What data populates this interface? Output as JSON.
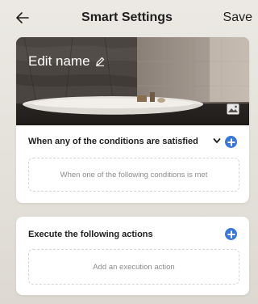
{
  "header": {
    "back_icon": "arrow-left-icon",
    "title": "Smart Settings",
    "save_label": "Save"
  },
  "scene": {
    "name_label": "Edit name",
    "edit_icon": "pencil-icon",
    "image_icon": "image-icon"
  },
  "conditions": {
    "title": "When any of the conditions are satisfied",
    "dropdown_icon": "chevron-down-icon",
    "add_icon": "plus-circle-icon",
    "placeholder": "When one of the following conditions is met"
  },
  "actions": {
    "title": "Execute the following actions",
    "add_icon": "plus-circle-icon",
    "placeholder": "Add an execution action"
  },
  "colors": {
    "accent": "#3a78d6",
    "text": "#1e1e1e",
    "muted": "#8c8c8c",
    "background": "#e8e5e0",
    "card": "#ffffff"
  }
}
